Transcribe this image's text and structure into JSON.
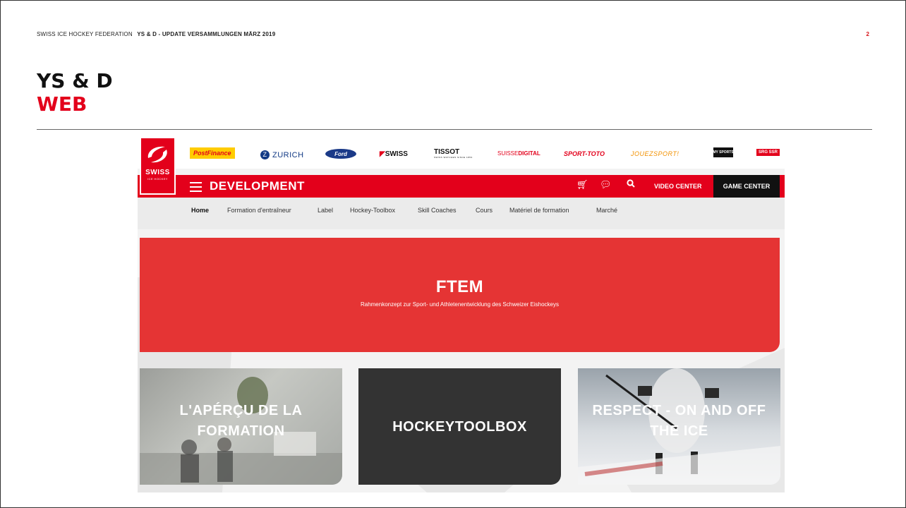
{
  "slide": {
    "org": "SWISS ICE HOCKEY FEDERATION",
    "subtitle": "YS & D - UPDATE VERSAMMLUNGEN MÄRZ 2019",
    "page": "2",
    "title_line1": "YS & D",
    "title_line2": "WEB"
  },
  "site": {
    "logo": {
      "line1": "SWISS",
      "line2": "ICE HOCKEY"
    },
    "sponsors": {
      "postfinance": "PostFinance",
      "zurich": "ZURICH",
      "ford": "Ford",
      "swiss": "SWISS",
      "tissot": "TISSOT",
      "tissot_tag": "SWISS WATCHES SINCE 1853",
      "suisse_digital_a": "SUISSE",
      "suisse_digital_b": "DIGITAL",
      "sport_toto": "SPORT-TOTO",
      "jouez_sport": "JOUEZSPORT!",
      "mysports": "MY SPORTS",
      "srg": "SRG SSR"
    },
    "nav": {
      "title": "DEVELOPMENT",
      "video_center": "VIDEO CENTER",
      "game_center": "GAME CENTER",
      "icons": [
        "cart-icon",
        "chat-icon",
        "search-icon"
      ]
    },
    "subnav": [
      "Home",
      "Formation d'entraîneur",
      "Label",
      "Hockey-Toolbox",
      "Skill Coaches",
      "Cours",
      "Matériel de formation",
      "Marché"
    ],
    "hero": {
      "title": "FTEM",
      "subtitle": "Rahmenkonzept zur Sport- und Athletenentwicklung des Schweizer Eishockeys"
    },
    "cards": [
      {
        "line1": "L'APÉRÇU DE LA",
        "line2": "FORMATION"
      },
      {
        "line1": "HOCKEYTOOLBOX",
        "line2": ""
      },
      {
        "line1": "RESPECT - ON AND OFF",
        "line2": "THE ICE"
      }
    ]
  },
  "colors": {
    "brand_red": "#e3001b",
    "hero_red": "#e53434",
    "dark_card": "#333333",
    "game_center_bg": "#111111"
  }
}
